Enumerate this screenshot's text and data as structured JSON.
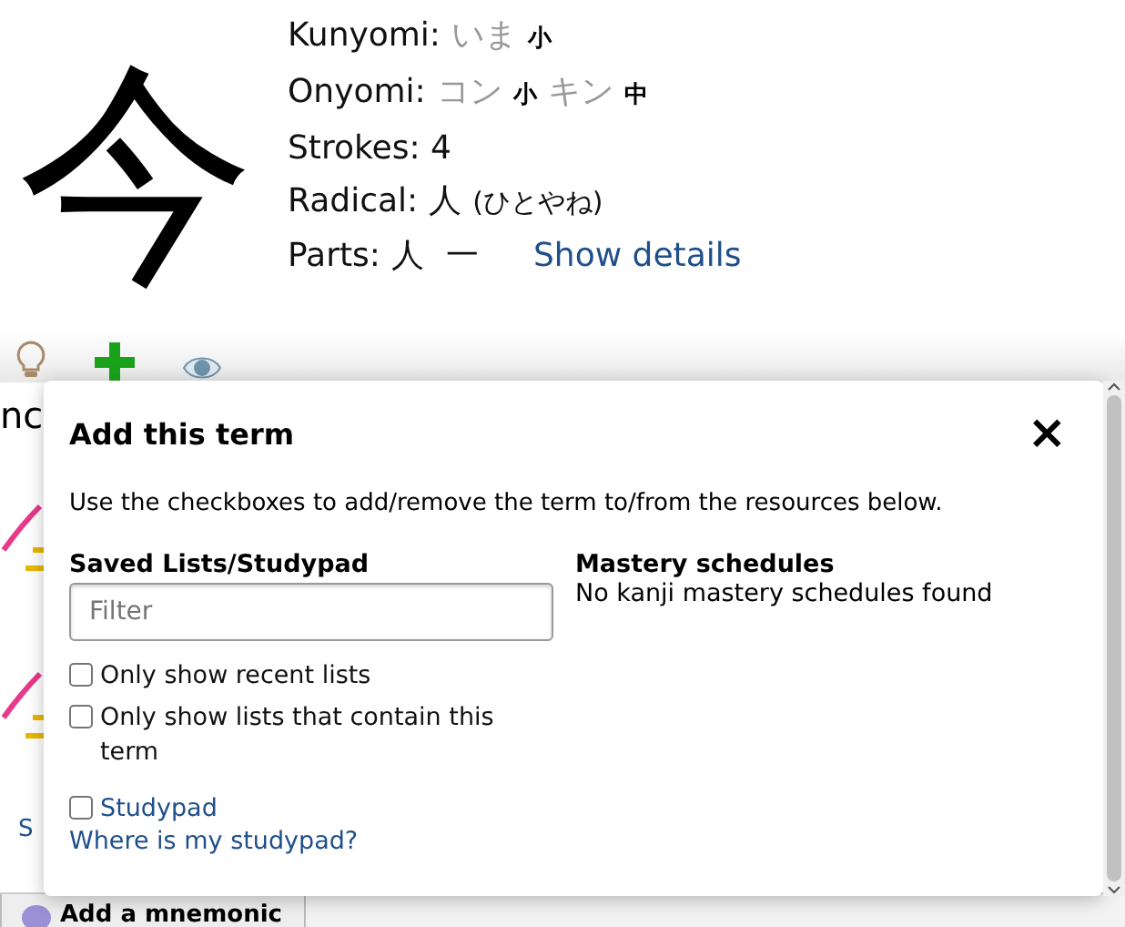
{
  "kanji": {
    "character": "今"
  },
  "info": {
    "kunyomi": {
      "label": "Kunyomi:",
      "readings": [
        {
          "kana": "いま",
          "mark": "小"
        }
      ]
    },
    "onyomi": {
      "label": "Onyomi:",
      "readings": [
        {
          "kana": "コン",
          "mark": "小"
        },
        {
          "kana": "キン",
          "mark": "中"
        }
      ]
    },
    "strokes": "Strokes: 4",
    "radical": {
      "label": "Radical:",
      "value": "人",
      "name": "(ひとやね)"
    },
    "parts": {
      "label": "Parts:",
      "items": [
        "人",
        "一"
      ],
      "link": "Show details"
    }
  },
  "background": {
    "cut_text": "nc",
    "cut_link": "S",
    "mnemonic_button": "Add a mnemonic"
  },
  "dialog": {
    "title": "Add this term",
    "close": "×",
    "description": "Use the checkboxes to add/remove the term to/from the resources below.",
    "lists": {
      "heading": "Saved Lists/Studypad",
      "filter": {
        "placeholder": "Filter"
      },
      "options": [
        {
          "label": "Only show recent lists",
          "checked": false,
          "kind": "plain"
        },
        {
          "label": "Only show lists that contain this term",
          "checked": false,
          "kind": "plain"
        },
        {
          "label": "Studypad",
          "checked": false,
          "kind": "link"
        }
      ],
      "help_link": "Where is my studypad?"
    },
    "mastery": {
      "heading": "Mastery schedules",
      "empty": "No kanji mastery schedules found"
    }
  }
}
